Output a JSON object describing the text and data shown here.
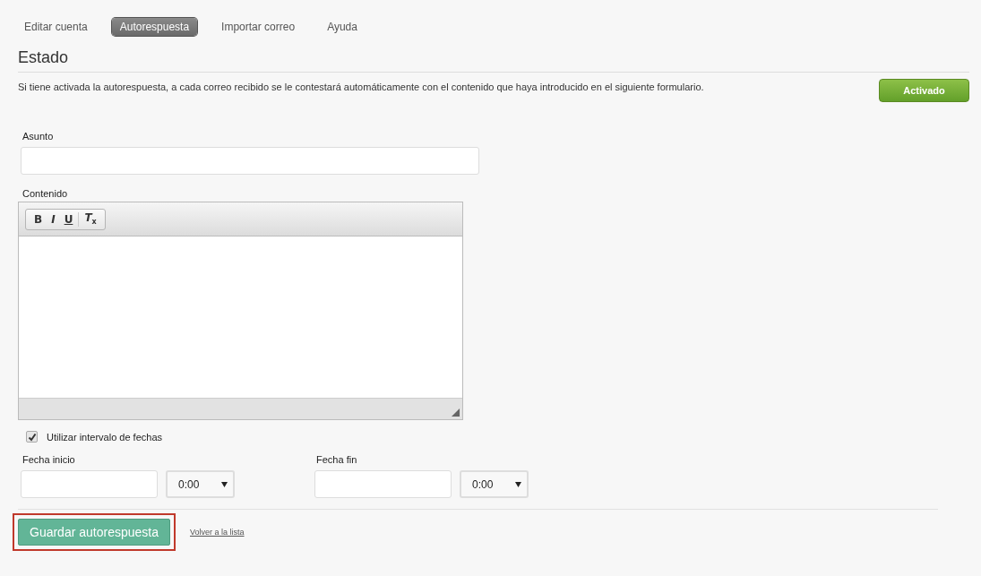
{
  "tabs": [
    {
      "label": "Editar cuenta",
      "selected": false
    },
    {
      "label": "Autorespuesta",
      "selected": true
    },
    {
      "label": "Importar correo",
      "selected": false
    },
    {
      "label": "Ayuda",
      "selected": false
    }
  ],
  "status": {
    "heading": "Estado",
    "description": "Si tiene activada la autorespuesta, a cada correo recibido se le contestará automáticamente con el contenido que haya introducido en el siguiente formulario.",
    "toggle": {
      "label": "Activado",
      "on": true
    }
  },
  "subject": {
    "label": "Asunto"
  },
  "content": {
    "label": "Contenido",
    "toolbar": [
      "B",
      "*I*",
      "U",
      "*T*$_{x}$"
    ]
  },
  "date_range": {
    "label": "Utilizar intervalo de fechas",
    "checked": true
  },
  "dates": [
    {
      "label": "Fecha inicio",
      "time": "0:00"
    },
    {
      "label": "Fecha fin",
      "time": "0:00"
    }
  ],
  "save": {
    "label": "Guardar autorespuesta",
    "highlighted": true
  },
  "back_link": "Volver a la lista"
}
